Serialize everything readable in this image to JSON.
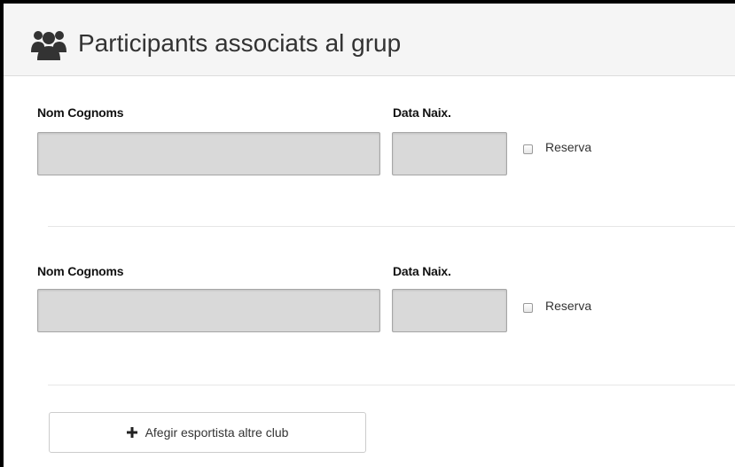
{
  "panel": {
    "title": "Participants associats al grup",
    "icon": "users-icon"
  },
  "participants": [
    {
      "name_label": "Nom Cognoms",
      "name_value": "",
      "date_label": "Data Naix.",
      "date_value": "",
      "reserve_label": "Reserva",
      "reserve_checked": false
    },
    {
      "name_label": "Nom Cognoms",
      "name_value": "",
      "date_label": "Data Naix.",
      "date_value": "",
      "reserve_label": "Reserva",
      "reserve_checked": false
    }
  ],
  "add_button": {
    "label": "Afegir esportista altre club",
    "icon": "plus-icon"
  }
}
